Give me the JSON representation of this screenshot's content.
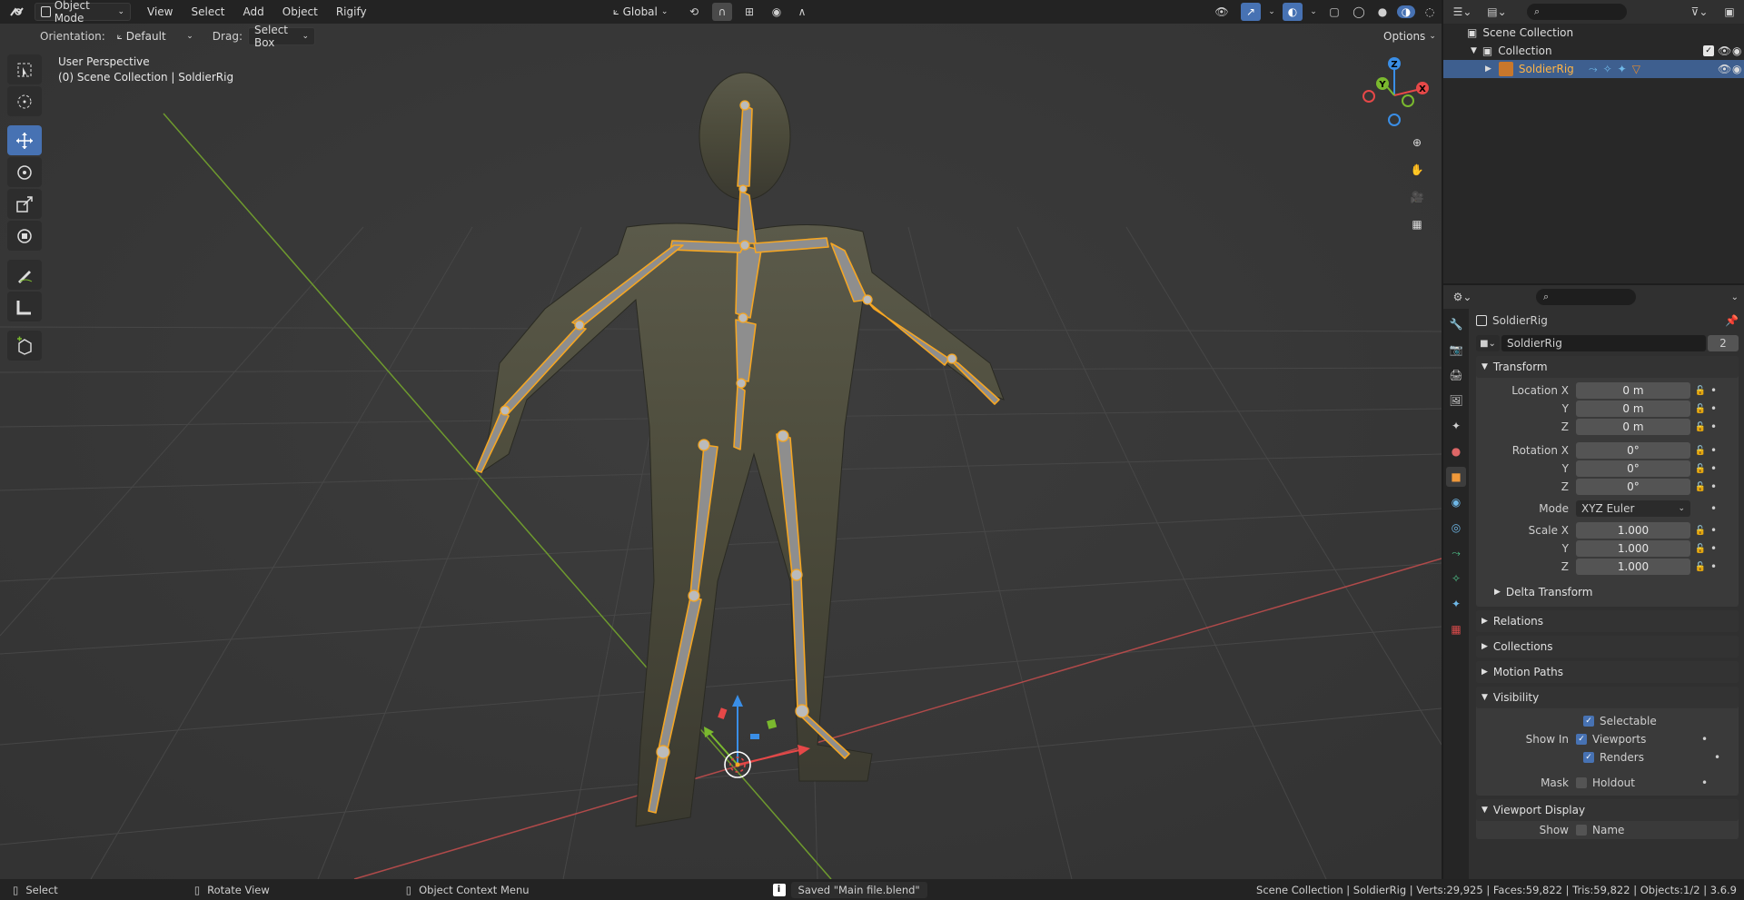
{
  "header": {
    "mode": "Object Mode",
    "menus": [
      "View",
      "Select",
      "Add",
      "Object",
      "Rigify"
    ],
    "transform_orientation": "Global"
  },
  "tool_header": {
    "orientation_label": "Orientation:",
    "orientation_value": "Default",
    "drag_label": "Drag:",
    "drag_value": "Select Box",
    "options_label": "Options"
  },
  "viewport": {
    "perspective": "User Perspective",
    "collection_info": "(0) Scene Collection | SoldierRig",
    "gizmo": {
      "x": "X",
      "y": "Y",
      "z": "Z"
    }
  },
  "toolbar": {
    "tools": [
      "select-box-tool",
      "cursor-tool",
      "move-tool",
      "rotate-tool",
      "scale-tool",
      "transform-tool",
      "annotate-tool",
      "measure-tool",
      "add-cube-tool"
    ],
    "active": "move-tool"
  },
  "outliner": {
    "scene_collection": "Scene Collection",
    "collection": "Collection",
    "object": "SoldierRig"
  },
  "properties": {
    "object_name": "SoldierRig",
    "datablock_name": "SoldierRig",
    "users": "2",
    "transform": {
      "title": "Transform",
      "location": {
        "label": "Location X",
        "x": "0 m",
        "y": "0 m",
        "z": "0 m"
      },
      "rotation": {
        "label": "Rotation X",
        "x": "0°",
        "y": "0°",
        "z": "0°"
      },
      "mode_label": "Mode",
      "mode": "XYZ Euler",
      "scale": {
        "label": "Scale X",
        "x": "1.000",
        "y": "1.000",
        "z": "1.000"
      },
      "y_label": "Y",
      "z_label": "Z",
      "delta": "Delta Transform"
    },
    "panels": [
      "Relations",
      "Collections",
      "Motion Paths"
    ],
    "visibility": {
      "title": "Visibility",
      "selectable": "Selectable",
      "show_in": "Show In",
      "viewports": "Viewports",
      "renders": "Renders",
      "mask": "Mask",
      "holdout": "Holdout"
    },
    "viewport_display": {
      "title": "Viewport Display",
      "show": "Show",
      "name": "Name"
    }
  },
  "status": {
    "select": "Select",
    "rotate": "Rotate View",
    "context": "Object Context Menu",
    "saved": "Saved \"Main file.blend\"",
    "stats": "Scene Collection | SoldierRig | Verts:29,925 | Faces:59,822 | Tris:59,822 | Objects:1/2 | 3.6.9"
  },
  "colors": {
    "accent": "#4772b3",
    "selected_orange": "#f5a623",
    "grid_x": "#b04a4a",
    "grid_y": "#6e9a2e"
  }
}
